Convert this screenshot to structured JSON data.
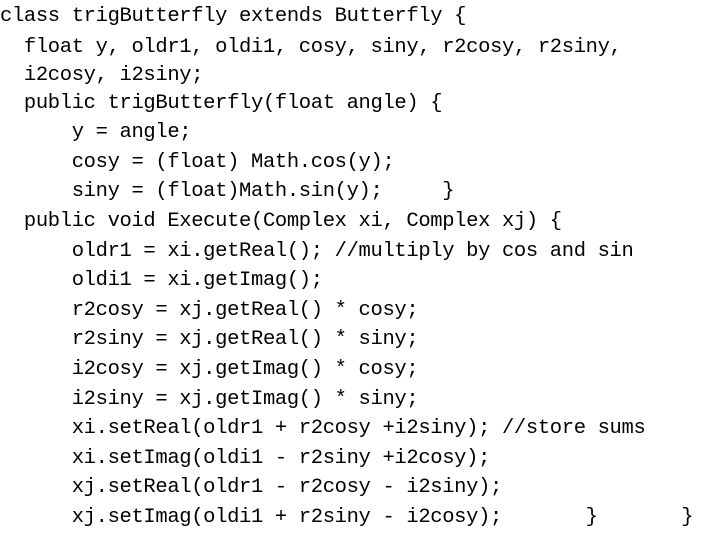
{
  "slide": {
    "background_color": "#ffffff",
    "text_color": "#000000",
    "language": "java",
    "class_name": "trigButterfly",
    "superclass": "Butterfly"
  },
  "code": {
    "lines": [
      "class trigButterfly extends Butterfly {",
      "  float y, oldr1, oldi1, cosy, siny, r2cosy, r2siny,",
      "  i2cosy, i2siny;",
      "  public trigButterfly(float angle) {",
      "      y = angle;",
      "      cosy = (float) Math.cos(y);",
      "      siny = (float)Math.sin(y);     }",
      "  public void Execute(Complex xi, Complex xj) {",
      "      oldr1 = xi.getReal(); //multiply by cos and sin",
      "      oldi1 = xi.getImag();",
      "      r2cosy = xj.getReal() * cosy;",
      "      r2siny = xj.getReal() * siny;",
      "      i2cosy = xj.getImag() * cosy;",
      "      i2siny = xj.getImag() * siny;",
      "      xi.setReal(oldr1 + r2cosy +i2siny); //store sums",
      "      xi.setImag(oldi1 - r2siny +i2cosy);",
      "      xj.setReal(oldr1 - r2cosy - i2siny);",
      "      xj.setImag(oldi1 + r2siny - i2cosy);       }       }"
    ],
    "comments": [
      "//multiply by cos and sin",
      "//store sums"
    ]
  }
}
